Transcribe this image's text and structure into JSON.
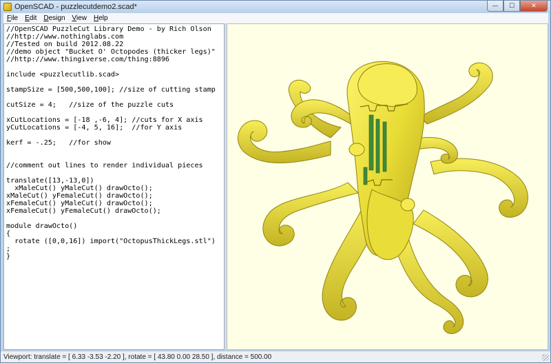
{
  "window": {
    "title": "OpenSCAD - puzzlecutdemo2.scad*",
    "controls": {
      "minimize": "—",
      "maximize": "☐",
      "close": "✕"
    }
  },
  "menubar": {
    "items": [
      {
        "label": "File",
        "mnemonic": "F",
        "rest": "ile"
      },
      {
        "label": "Edit",
        "mnemonic": "E",
        "rest": "dit"
      },
      {
        "label": "Design",
        "mnemonic": "D",
        "rest": "esign"
      },
      {
        "label": "View",
        "mnemonic": "V",
        "rest": "iew"
      },
      {
        "label": "Help",
        "mnemonic": "H",
        "rest": "elp"
      }
    ]
  },
  "editor": {
    "lines": [
      "//OpenSCAD PuzzleCut Library Demo - by Rich Olson",
      "//http://www.nothinglabs.com",
      "//Tested on build 2012.08.22",
      "//demo object \"Bucket O' Octopodes (thicker legs)\"",
      "//http://www.thingiverse.com/thing:8896",
      "",
      "include <puzzlecutlib.scad>",
      "",
      "stampSize = [500,500,100]; //size of cutting stamp",
      "",
      "cutSize = 4;   //size of the puzzle cuts",
      "",
      "xCutLocations = [-18 ,-6, 4]; //cuts for X axis",
      "yCutLocations = [-4, 5, 16];  //for Y axis",
      "",
      "kerf = -.25;   //for show",
      "",
      "",
      "//comment out lines to render individual pieces",
      "",
      "translate([13,-13,0])",
      "  xMaleCut() yMaleCut() drawOcto();",
      "xMaleCut() yFemaleCut() drawOcto();",
      "xFemaleCut() yMaleCut() drawOcto();",
      "xFemaleCut() yFemaleCut() drawOcto();",
      "",
      "module drawOcto()",
      "{",
      "  rotate ([0,0,16]) import(\"OctopusThickLegs.stl\")",
      ";",
      "}"
    ]
  },
  "viewport": {
    "background": "#ffffe5",
    "model_color": "#f2e94a",
    "cut_color": "#3f8a3a",
    "object": "octopus-model"
  },
  "statusbar": {
    "text": "Viewport: translate = [ 6.33 -3.53 -2.20 ], rotate = [ 43.80 0.00 28.50 ], distance = 500.00"
  }
}
